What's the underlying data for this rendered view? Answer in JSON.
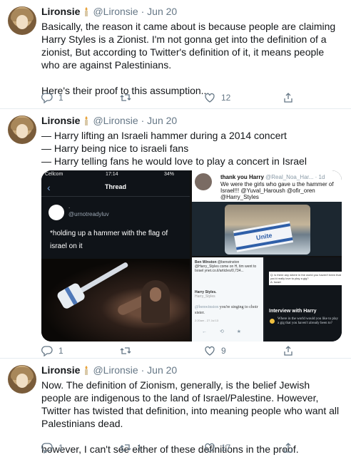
{
  "tweets": [
    {
      "name": "Lironsie",
      "handle": "@Lironsie",
      "date": "Jun 20",
      "paragraphs": [
        "Basically, the reason it came about is because people are claiming Harry Styles is a Zionist. I'm not gonna get into the definition of a zionist, But according to Twitter's definition of it, it means people who are against Palestinians.",
        "Here's their proof to this assumption..."
      ],
      "reply_count": "1",
      "retweet_count": "",
      "like_count": "12"
    },
    {
      "name": "Lironsie",
      "handle": "@Lironsie",
      "date": "Jun 20",
      "lines": [
        "— Harry lifting an Israeli hammer during a 2014 concert",
        "— Harry being nice to israeli fans",
        "— Harry telling fans he would love to play a concert in Israel"
      ],
      "media": {
        "phone_status_left": "Cellcom",
        "phone_time": "17:14",
        "phone_battery": "34%",
        "thread_title": "Thread",
        "thread_user": "@urnotreadyluv",
        "thread_dot": ".",
        "thread_text": "*holding up a hammer with the flag of israel on it",
        "tr_name": "thank you Harry",
        "tr_handle": "@Real_Noa_Har... · 1d",
        "tr_text": "We were the girls who gave u the hammer of Israel!!! @Yuval_Haroush @ofir_oren @Harry_Styles",
        "tr_flag_text": "Unite",
        "bl_header": "Ben Winston",
        "bl_header_handle": "@benwinston",
        "bl_text": "@Harry_Styles come on H, tim went to Israel ynet.co.il/articles/0,734...",
        "bl_hs_name": "Harry Styles.",
        "bl_hs_handle": "Harry_Styles",
        "bl_handle": "@benwinston",
        "bl_reply": "you're singing to choir sister.",
        "bl_time": "2:20am - 27 Jul 13",
        "bl_icons": "← ⟲ ★",
        "br_question": "Q: is there any where in the world you haven't been that you'd really love to play a gig?",
        "br_question_by": "A: Israel",
        "br_title": "Interview with Harry",
        "br_answer": "Where in the world would you like to play a gig that you haven't already been to?"
      },
      "reply_count": "1",
      "retweet_count": "",
      "like_count": "9"
    },
    {
      "name": "Lironsie",
      "handle": "@Lironsie",
      "date": "Jun 20",
      "paragraphs": [
        "Now. The definition of Zionism, generally, is the belief Jewish people are indigenous to the land of Israel/Palestine. However, Twitter has twisted that definition, into meaning people who want all Palestinians dead.",
        "however, I can't see either of these definitions in the proof."
      ],
      "reply_count": "1",
      "retweet_count": "1",
      "like_count": "17"
    }
  ],
  "colors": {
    "text": "#14171a",
    "muted": "#657786",
    "border": "#e6ecf0"
  }
}
